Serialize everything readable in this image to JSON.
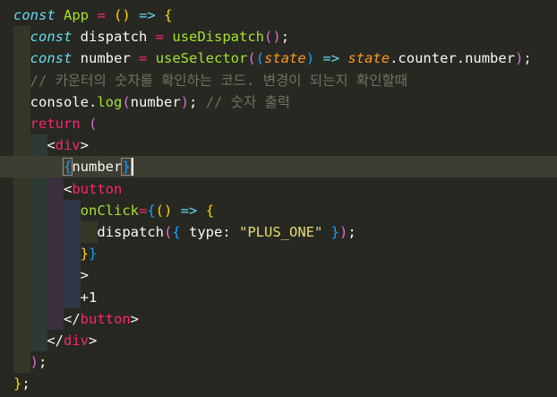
{
  "editor": {
    "lines": [
      [
        [
          "kw",
          "const"
        ],
        [
          "txt",
          " "
        ],
        [
          "id",
          "App"
        ],
        [
          "txt",
          " "
        ],
        [
          "op",
          "="
        ],
        [
          "txt",
          " "
        ],
        [
          "b1",
          "()"
        ],
        [
          "txt",
          " "
        ],
        [
          "kw",
          "=>"
        ],
        [
          "txt",
          " "
        ],
        [
          "b1",
          "{"
        ]
      ],
      [
        [
          "kw",
          "const"
        ],
        [
          "txt",
          " dispatch "
        ],
        [
          "op",
          "="
        ],
        [
          "txt",
          " "
        ],
        [
          "fn",
          "useDispatch"
        ],
        [
          "b2",
          "()"
        ],
        [
          "txt",
          ";"
        ]
      ],
      [
        [
          "kw",
          "const"
        ],
        [
          "txt",
          " number "
        ],
        [
          "op",
          "="
        ],
        [
          "txt",
          " "
        ],
        [
          "fn",
          "useSelector"
        ],
        [
          "b2",
          "("
        ],
        [
          "b3",
          "("
        ],
        [
          "param",
          "state"
        ],
        [
          "b3",
          ")"
        ],
        [
          "txt",
          " "
        ],
        [
          "kw",
          "=>"
        ],
        [
          "txt",
          " "
        ],
        [
          "param",
          "state"
        ],
        [
          "txt",
          ".counter.number"
        ],
        [
          "b2",
          ")"
        ],
        [
          "txt",
          ";"
        ]
      ],
      [
        [
          "cm",
          "// 카운터의 숫자를 확인하는 코드. 변경이 되는지 확인할때"
        ]
      ],
      [
        [
          "txt",
          "console."
        ],
        [
          "fn",
          "log"
        ],
        [
          "b2",
          "("
        ],
        [
          "txt",
          "number"
        ],
        [
          "b2",
          ")"
        ],
        [
          "txt",
          "; "
        ],
        [
          "cm",
          "// 숫자 출력"
        ]
      ],
      [
        [
          "op",
          "return"
        ],
        [
          "txt",
          " "
        ],
        [
          "b2",
          "("
        ]
      ],
      [
        [
          "txt",
          "<"
        ],
        [
          "tag",
          "div"
        ],
        [
          "txt",
          ">"
        ]
      ],
      [
        [
          "b3",
          "{"
        ],
        [
          "txt",
          "number"
        ],
        [
          "b3",
          "}"
        ]
      ],
      [
        [
          "txt",
          "<"
        ],
        [
          "tag",
          "button"
        ]
      ],
      [
        [
          "attr",
          "onClick"
        ],
        [
          "op",
          "="
        ],
        [
          "b3",
          "{"
        ],
        [
          "b1",
          "()"
        ],
        [
          "txt",
          " "
        ],
        [
          "kw",
          "=>"
        ],
        [
          "txt",
          " "
        ],
        [
          "b1",
          "{"
        ]
      ],
      [
        [
          "txt",
          "dispatch"
        ],
        [
          "b2",
          "("
        ],
        [
          "b3",
          "{"
        ],
        [
          "txt",
          " type: "
        ],
        [
          "str",
          "\"PLUS_ONE\""
        ],
        [
          "txt",
          " "
        ],
        [
          "b3",
          "}"
        ],
        [
          "b2",
          ")"
        ],
        [
          "txt",
          ";"
        ]
      ],
      [
        [
          "b1",
          "}"
        ],
        [
          "b3",
          "}"
        ]
      ],
      [
        [
          "txt",
          ">"
        ]
      ],
      [
        [
          "txt",
          "+1"
        ]
      ],
      [
        [
          "txt",
          "</"
        ],
        [
          "tag",
          "button"
        ],
        [
          "txt",
          ">"
        ]
      ],
      [
        [
          "txt",
          "</"
        ],
        [
          "tag",
          "div"
        ],
        [
          "txt",
          ">"
        ]
      ],
      [
        [
          "b2",
          ")"
        ],
        [
          "txt",
          ";"
        ]
      ],
      [
        [
          "b1",
          "}"
        ],
        [
          "txt",
          ";"
        ]
      ]
    ]
  }
}
